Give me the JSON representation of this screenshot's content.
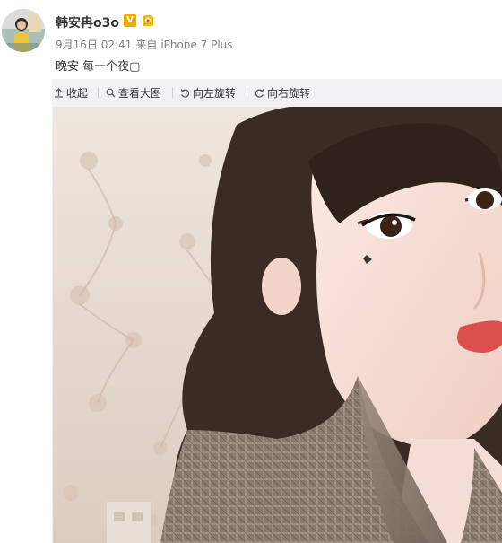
{
  "post": {
    "username": "韩安冉o3o",
    "verified_icon": "V",
    "timestamp": "9月16日 02:41",
    "via": "来自",
    "device": "iPhone 7 Plus",
    "text": "晚安 每一个夜▢"
  },
  "media_toolbar": {
    "collapse": "收起",
    "view_large": "查看大图",
    "rotate_left": "向左旋转",
    "rotate_right": "向右旋转"
  },
  "colors": {
    "verified": "#f2a900",
    "toolbar_bg": "#f2f2f5",
    "meta_text": "#808080"
  },
  "icons": [
    "avatar",
    "verified-icon",
    "member-icon",
    "collapse-icon",
    "search-icon",
    "rotate-left-icon",
    "rotate-right-icon"
  ]
}
